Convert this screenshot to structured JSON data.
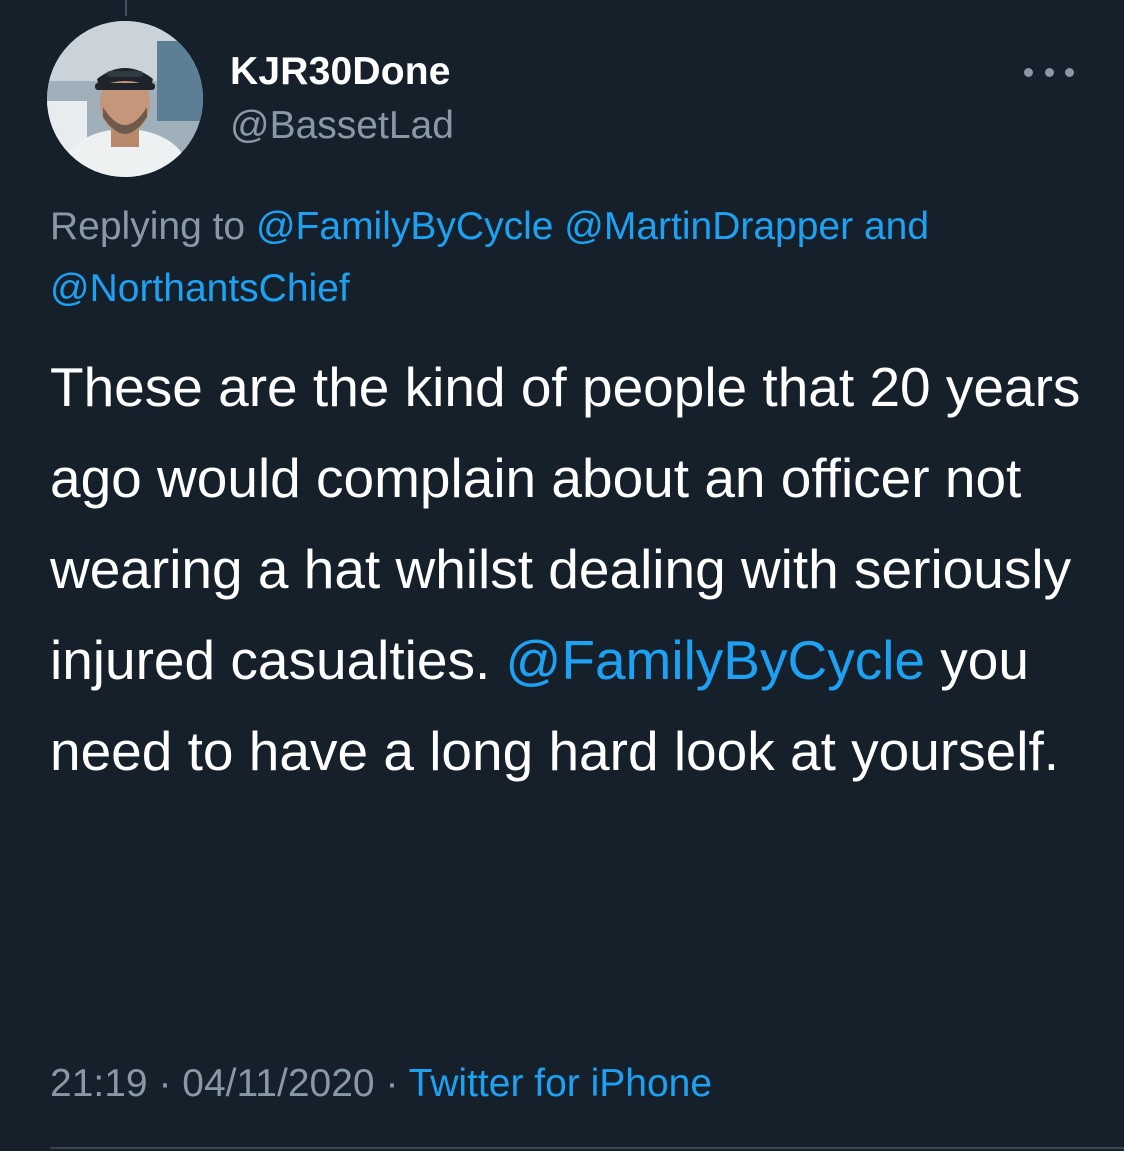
{
  "tweet": {
    "author": {
      "display_name": "KJR30Done",
      "handle": "@BassetLad",
      "avatar_icon": "profile-photo"
    },
    "more_icon": "more-horizontal-icon",
    "replying_to": {
      "prefix": "Replying to",
      "mentions": [
        "@FamilyByCycle",
        "@MartinDrapper",
        "@NorthantsChief"
      ],
      "conjunction": "and"
    },
    "text": {
      "before_mention": "These are the kind of people that 20 years ago would complain about an officer not wearing a hat whilst dealing with seriously injured casualties.",
      "mention": "@FamilyByCycle",
      "after_mention": "you need to have a long hard look at yourself."
    },
    "meta": {
      "time": "21:19",
      "separator": "·",
      "date": "04/11/2020",
      "source": "Twitter for iPhone"
    }
  },
  "colors": {
    "background": "#15202b",
    "primary_text": "#ffffff",
    "secondary_text": "#8899a6",
    "link": "#1da1f2",
    "divider": "#38444d"
  }
}
